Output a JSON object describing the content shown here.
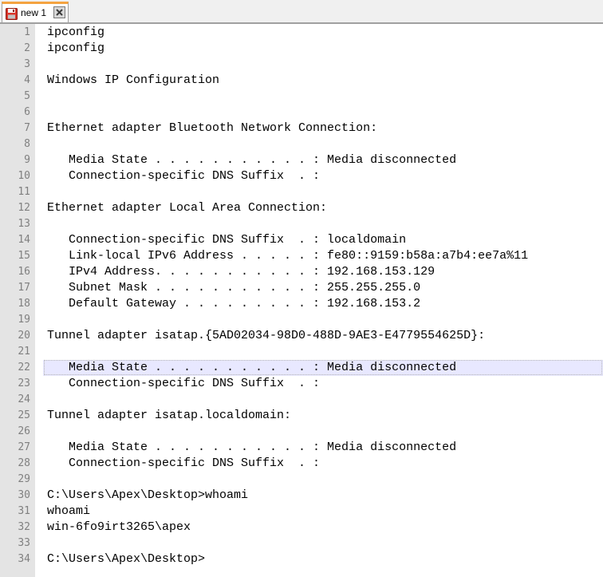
{
  "tab": {
    "label": "new 1",
    "icon": "save-disk-icon",
    "close_icon": "close-icon",
    "accent_color": "#f4a340"
  },
  "editor": {
    "current_line": 22,
    "lines": [
      "ipconfig",
      "ipconfig",
      "",
      "Windows IP Configuration",
      "",
      "",
      "Ethernet adapter Bluetooth Network Connection:",
      "",
      "   Media State . . . . . . . . . . . : Media disconnected",
      "   Connection-specific DNS Suffix  . :",
      "",
      "Ethernet adapter Local Area Connection:",
      "",
      "   Connection-specific DNS Suffix  . : localdomain",
      "   Link-local IPv6 Address . . . . . : fe80::9159:b58a:a7b4:ee7a%11",
      "   IPv4 Address. . . . . . . . . . . : 192.168.153.129",
      "   Subnet Mask . . . . . . . . . . . : 255.255.255.0",
      "   Default Gateway . . . . . . . . . : 192.168.153.2",
      "",
      "Tunnel adapter isatap.{5AD02034-98D0-488D-9AE3-E4779554625D}:",
      "",
      "   Media State . . . . . . . . . . . : Media disconnected",
      "   Connection-specific DNS Suffix  . :",
      "",
      "Tunnel adapter isatap.localdomain:",
      "",
      "   Media State . . . . . . . . . . . : Media disconnected",
      "   Connection-specific DNS Suffix  . :",
      "",
      "C:\\Users\\Apex\\Desktop>whoami",
      "whoami",
      "win-6fo9irt3265\\apex",
      "",
      "C:\\Users\\Apex\\Desktop>"
    ]
  }
}
